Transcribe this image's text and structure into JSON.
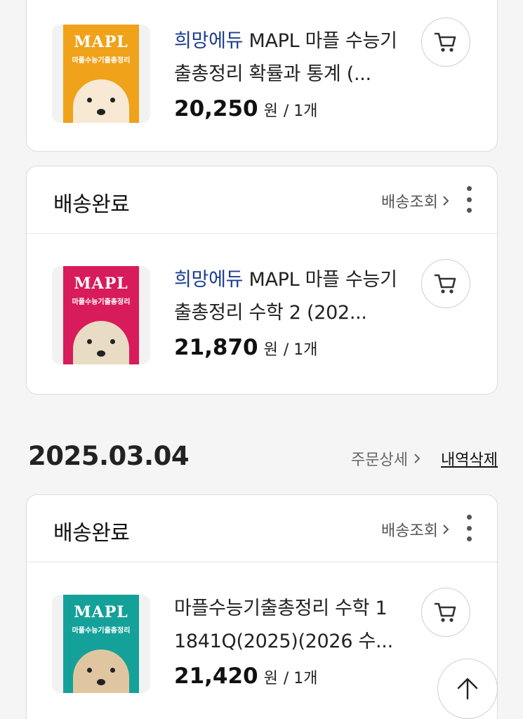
{
  "orders": [
    {
      "status": "",
      "item": {
        "brand": "희망에듀",
        "title": " MAPL 마플 수능기출총정리 확률과 통계 (...",
        "price": "20,250",
        "unit": "원",
        "qty": "/ 1개",
        "cover": {
          "logo": "MAPL",
          "subtitle": "마플수능기출총정리",
          "bg": "#f0a21a",
          "face": "#f7e9d4",
          "ink": "#ffe600"
        }
      }
    },
    {
      "status": "배송완료",
      "track_label": "배송조회",
      "item": {
        "brand": "희망에듀",
        "title": " MAPL 마플 수능기출총정리 수학 2 (202...",
        "price": "21,870",
        "unit": "원",
        "qty": "/ 1개",
        "cover": {
          "logo": "MAPL",
          "subtitle": "마플수능기출총정리",
          "bg": "#d81b5a",
          "face": "#e9dcc4",
          "ink": "#ffffff"
        }
      }
    },
    {
      "status": "배송완료",
      "track_label": "배송조회",
      "item": {
        "brand": "",
        "title": "마플수능기출총정리 수학 1 1841Q(2025)(2026 수...",
        "price": "21,420",
        "unit": "원",
        "qty": "/ 1개",
        "cover": {
          "logo": "MAPL",
          "subtitle": "마플수능기출총정리",
          "bg": "#14a19a",
          "face": "#e0c6a0",
          "ink": "#ffffff"
        }
      }
    }
  ],
  "date_section": {
    "date": "2025.03.04",
    "detail_label": "주문상세",
    "delete_label": "내역삭제"
  },
  "icons": {
    "cart": "cart-icon",
    "kebab": "more-vertical-icon",
    "chevron": "chevron-right-icon",
    "top": "arrow-up-icon"
  }
}
